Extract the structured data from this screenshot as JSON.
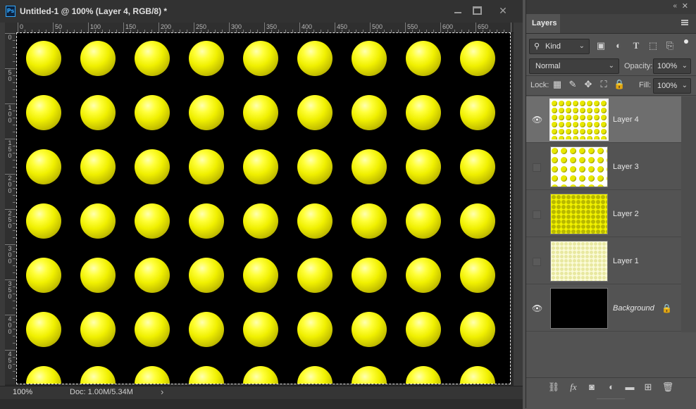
{
  "document": {
    "title": "Untitled-1 @ 100% (Layer 4, RGB/8) *",
    "app_badge": "Ps",
    "ruler_h": [
      "0",
      "50",
      "100",
      "150",
      "200",
      "250",
      "300",
      "350",
      "400",
      "450",
      "500",
      "550",
      "600",
      "650"
    ],
    "ruler_v": [
      "0",
      "5 0",
      "1 0 0",
      "1 5 0",
      "2 0 0",
      "2 5 0",
      "3 0 0",
      "3 5 0",
      "4 0 0",
      "4 5 0"
    ],
    "ball_color": "#f0f000",
    "canvas_color": "#000000",
    "grid": {
      "rows": 7,
      "cols": 9
    }
  },
  "status": {
    "zoom": "100%",
    "doc": "Doc: 1.00M/5.34M",
    "chevron": "›"
  },
  "panel": {
    "tab_label": "Layers",
    "collapse_icon": "«",
    "close_icon": "✕",
    "filter_kind": "Kind",
    "blend_mode": "Normal",
    "opacity_label": "Opacity:",
    "opacity_value": "100%",
    "lock_label": "Lock:",
    "fill_label": "Fill:",
    "fill_value": "100%",
    "layers": [
      {
        "name": "Layer 4",
        "visible": true,
        "active": true,
        "italic": false
      },
      {
        "name": "Layer 3",
        "visible": false,
        "active": false,
        "italic": false
      },
      {
        "name": "Layer 2",
        "visible": false,
        "active": false,
        "italic": false
      },
      {
        "name": "Layer 1",
        "visible": false,
        "active": false,
        "italic": false
      },
      {
        "name": "Background",
        "visible": true,
        "active": false,
        "italic": true,
        "locked": true
      }
    ]
  }
}
